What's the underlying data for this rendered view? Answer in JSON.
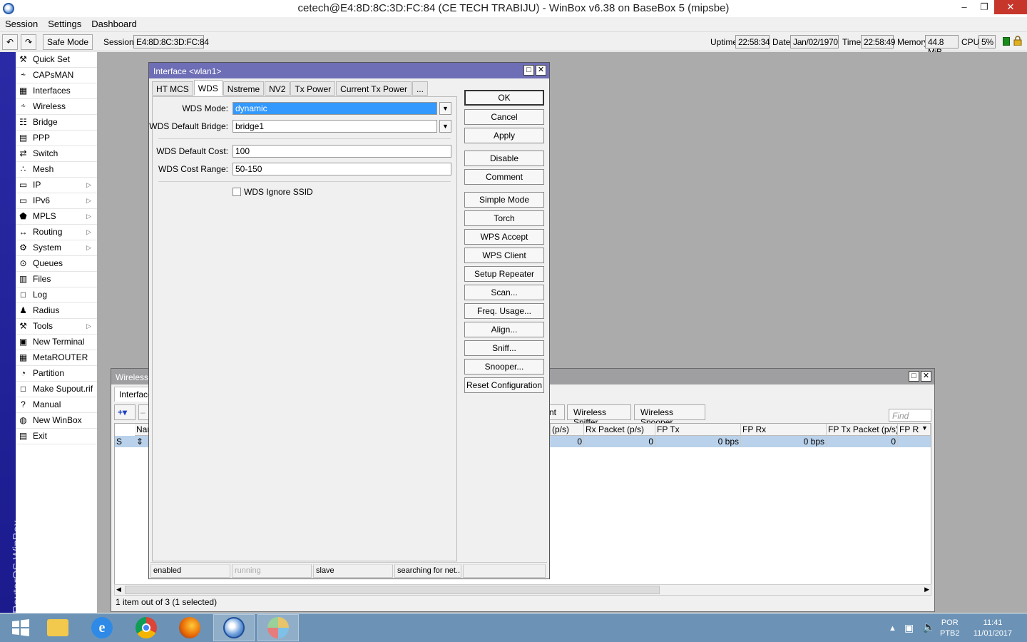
{
  "window": {
    "title": "cetech@E4:8D:8C:3D:FC:84 (CE TECH TRABIJU) - WinBox v6.38 on BaseBox 5 (mipsbe)",
    "min": "–",
    "max": "❐",
    "close": "✕"
  },
  "menu": [
    "Session",
    "Settings",
    "Dashboard"
  ],
  "toolbar": {
    "undo": "↶",
    "redo": "↷",
    "safe_mode": "Safe Mode",
    "session_label": "Session:",
    "session_value": "E4:8D:8C:3D:FC:84",
    "uptime_label": "Uptime:",
    "uptime": "22:58:34",
    "date_label": "Date:",
    "date": "Jan/02/1970",
    "time_label": "Time:",
    "time": "22:58:49",
    "memory_label": "Memory:",
    "memory": "44.8 MiB",
    "cpu_label": "CPU:",
    "cpu": "5%"
  },
  "sidebar": {
    "brand": "RouterOS WinBox",
    "items": [
      {
        "label": "Quick Set",
        "icon": "⚒"
      },
      {
        "label": "CAPsMAN",
        "icon": "⸞"
      },
      {
        "label": "Interfaces",
        "icon": "▦"
      },
      {
        "label": "Wireless",
        "icon": "⸞"
      },
      {
        "label": "Bridge",
        "icon": "☷"
      },
      {
        "label": "PPP",
        "icon": "▤"
      },
      {
        "label": "Switch",
        "icon": "⇄"
      },
      {
        "label": "Mesh",
        "icon": "∴"
      },
      {
        "label": "IP",
        "icon": "▭",
        "arrow": "▷"
      },
      {
        "label": "IPv6",
        "icon": "▭",
        "arrow": "▷"
      },
      {
        "label": "MPLS",
        "icon": "⬟",
        "arrow": "▷"
      },
      {
        "label": "Routing",
        "icon": "↔",
        "arrow": "▷"
      },
      {
        "label": "System",
        "icon": "⚙",
        "arrow": "▷"
      },
      {
        "label": "Queues",
        "icon": "⊙"
      },
      {
        "label": "Files",
        "icon": "▥"
      },
      {
        "label": "Log",
        "icon": "□"
      },
      {
        "label": "Radius",
        "icon": "♟"
      },
      {
        "label": "Tools",
        "icon": "⚒",
        "arrow": "▷"
      },
      {
        "label": "New Terminal",
        "icon": "▣"
      },
      {
        "label": "MetaROUTER",
        "icon": "▦"
      },
      {
        "label": "Partition",
        "icon": "◔"
      },
      {
        "label": "Make Supout.rif",
        "icon": "□"
      },
      {
        "label": "Manual",
        "icon": "?"
      },
      {
        "label": "New WinBox",
        "icon": "◍"
      },
      {
        "label": "Exit",
        "icon": "▤"
      }
    ]
  },
  "wireless_window": {
    "title": "Wireless T",
    "tab": "Interface",
    "add_button": "+▾",
    "remove_button": "–",
    "buttons": [
      "nt",
      "Wireless Sniffer",
      "Wireless Snooper"
    ],
    "find_placeholder": "Find",
    "columns": [
      "Nar",
      "(p/s)",
      "Rx Packet (p/s)",
      "FP Tx",
      "FP Rx",
      "FP Tx Packet (p/s)",
      "FP Rx"
    ],
    "row": {
      "flag": "S",
      "cells": [
        "0",
        "0",
        "0 bps",
        "0 bps",
        "0"
      ]
    },
    "status": "1 item out of 3 (1 selected)"
  },
  "dialog": {
    "title": "Interface <wlan1>",
    "tabs": [
      "HT MCS",
      "WDS",
      "Nstreme",
      "NV2",
      "Tx Power",
      "Current Tx Power",
      "..."
    ],
    "active_tab": "WDS",
    "fields": {
      "wds_mode_label": "WDS Mode:",
      "wds_mode": "dynamic",
      "wds_bridge_label": "WDS Default Bridge:",
      "wds_bridge": "bridge1",
      "wds_cost_label": "WDS Default Cost:",
      "wds_cost": "100",
      "wds_range_label": "WDS Cost Range:",
      "wds_range": "50-150",
      "ignore_ssid_label": "WDS Ignore SSID"
    },
    "buttons": [
      "OK",
      "Cancel",
      "Apply",
      "Disable",
      "Comment",
      "Simple Mode",
      "Torch",
      "WPS Accept",
      "WPS Client",
      "Setup Repeater",
      "Scan...",
      "Freq. Usage...",
      "Align...",
      "Sniff...",
      "Snooper...",
      "Reset Configuration"
    ],
    "status": [
      "enabled",
      "running",
      "slave",
      "searching for net..."
    ]
  },
  "taskbar": {
    "lang": "POR",
    "layout": "PTB2",
    "clock": "11:41",
    "date": "11/01/2017"
  }
}
